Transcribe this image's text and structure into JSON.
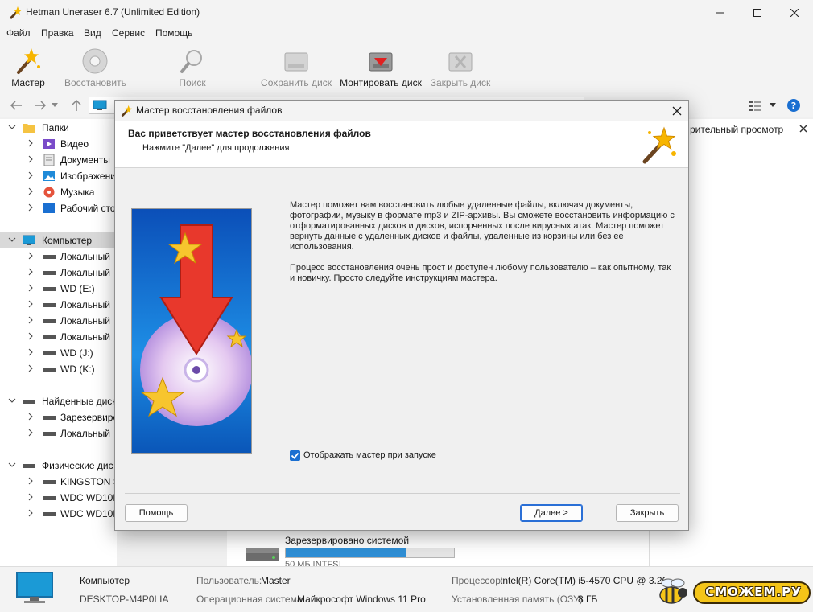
{
  "window": {
    "title": "Hetman Uneraser 6.7 (Unlimited Edition)"
  },
  "menu": [
    "Файл",
    "Правка",
    "Вид",
    "Сервис",
    "Помощь"
  ],
  "toolbar": {
    "wizard": "Мастер",
    "restore": "Восстановить",
    "search": "Поиск",
    "save_disk": "Сохранить диск",
    "mount_disk": "Монтировать диск",
    "close_disk": "Закрыть диск"
  },
  "tree": {
    "folders": "Папки",
    "folder_items": [
      "Видео",
      "Документы",
      "Изображени",
      "Музыка",
      "Рабочий сто"
    ],
    "computer": "Компьютер",
    "computer_items": [
      "Локальный",
      "Локальный",
      "WD (E:)",
      "Локальный",
      "Локальный",
      "Локальный",
      "WD (J:)",
      "WD (K:)"
    ],
    "found_disks": "Найденные диск",
    "found_items": [
      "Зарезервиро",
      "Локальный"
    ],
    "physical": "Физические дис",
    "physical_items": [
      "KINGSTON S",
      "WDC WD10E",
      "WDC WD10E"
    ]
  },
  "preview": {
    "header": "рительный просмотр"
  },
  "center": {
    "disk_name": "Зарезервировано системой",
    "disk_info": "50 МБ [NTFS]",
    "fill": 0.72
  },
  "status": {
    "computer_label": "Компьютер",
    "computer_name": "DESKTOP-M4P0LIA",
    "user_key": "Пользователь:",
    "user_val": "Master",
    "os_key": "Операционная система:",
    "os_val": "Майкрософт Windows 11 Pro",
    "cpu_key": "Процессор:",
    "cpu_val": "Intel(R) Core(TM) i5-4570 CPU @ 3.20GHz",
    "ram_key": "Установленная память (ОЗУ):",
    "ram_val": "8 ГБ"
  },
  "dialog": {
    "title": "Мастер восстановления файлов",
    "heading": "Вас приветствует мастер восстановления файлов",
    "subheading": "Нажмите \"Далее\" для продолжения",
    "para1": "Мастер поможет вам восстановить любые удаленные файлы, включая документы, фотографии, музыку в формате mp3 и ZIP-архивы. Вы сможете восстановить информацию с отформатированных дисков и дисков, испорченных после вирусных атак. Мастер поможет вернуть данные с удаленных дисков и файлы, удаленные из корзины или без ее использования.",
    "para2": "Процесс восстановления очень прост и доступен любому пользователю – как опытному, так и новичку. Просто следуйте инструкциям мастера.",
    "checkbox": "Отображать мастер при запуске",
    "btn_help": "Помощь",
    "btn_next": "Далее >",
    "btn_close": "Закрыть"
  },
  "watermark": {
    "text": "СМОЖЕМ.РУ"
  },
  "colors": {
    "accent": "#1a6fd1",
    "selection": "#d9d9d9",
    "progress": "#2f8fd6"
  }
}
